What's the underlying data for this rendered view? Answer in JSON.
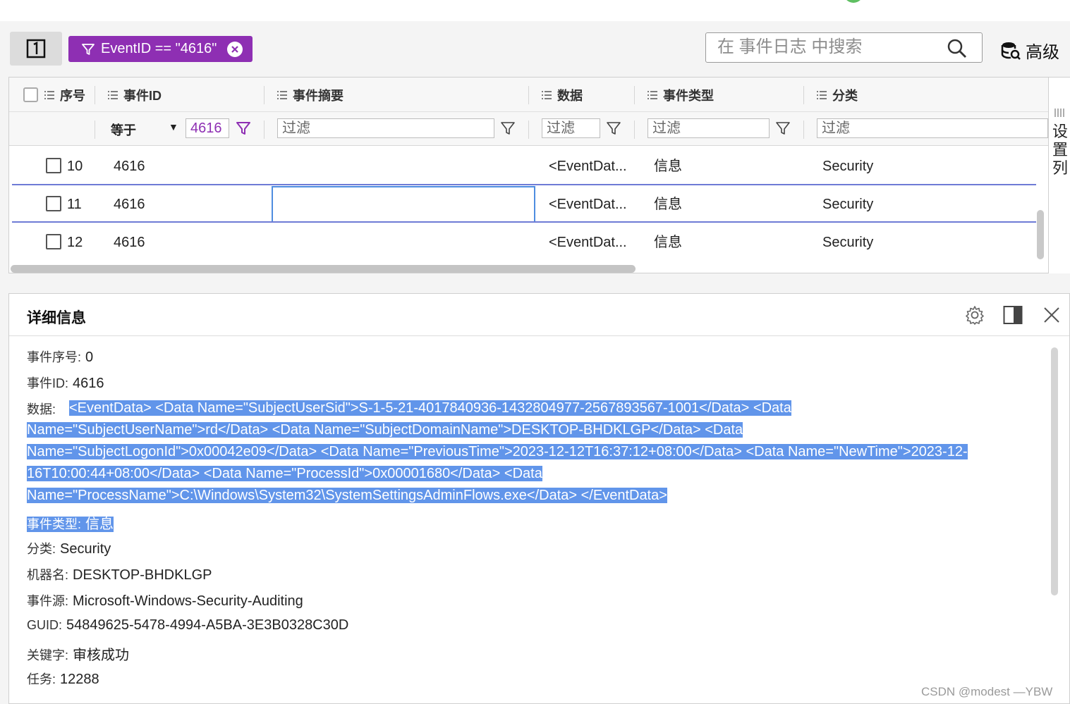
{
  "toolbar": {
    "filter_chip_label": "EventID == \"4616\"",
    "search_placeholder": "在 事件日志 中搜索",
    "advanced_label": "高级"
  },
  "grid": {
    "columns": [
      "序号",
      "事件ID",
      "事件摘要",
      "数据",
      "事件类型",
      "分类"
    ],
    "filter_operator": "等于",
    "filter_eventid_value": "4616",
    "filter_placeholder": "过滤",
    "column_settings_label": [
      "设",
      "置",
      "列"
    ],
    "rows": [
      {
        "seq": "10",
        "event_id": "4616",
        "summary": "",
        "data": "<EventDat...",
        "type": "信息",
        "category": "Security"
      },
      {
        "seq": "11",
        "event_id": "4616",
        "summary": "",
        "data": "<EventDat...",
        "type": "信息",
        "category": "Security"
      },
      {
        "seq": "12",
        "event_id": "4616",
        "summary": "",
        "data": "<EventDat...",
        "type": "信息",
        "category": "Security"
      }
    ]
  },
  "details": {
    "title": "详细信息",
    "seq_label": "事件序号:",
    "seq_value": "0",
    "id_label": "事件ID:",
    "id_value": "4616",
    "data_label": "数据:",
    "data_lines": [
      "<EventData> <Data Name=\"SubjectUserSid\">S-1-5-21-4017840936-1432804977-2567893567-1001</Data> <Data",
      "Name=\"SubjectUserName\">rd</Data> <Data Name=\"SubjectDomainName\">DESKTOP-BHDKLGP</Data> <Data",
      "Name=\"SubjectLogonId\">0x00042e09</Data> <Data Name=\"PreviousTime\">2023-12-12T16:37:12+08:00</Data> <Data Name=\"NewTime\">2023-12-",
      "16T10:00:44+08:00</Data> <Data Name=\"ProcessId\">0x00001680</Data> <Data",
      "Name=\"ProcessName\">C:\\Windows\\System32\\SystemSettingsAdminFlows.exe</Data> </EventData>"
    ],
    "type_label": "事件类型:",
    "type_value": "信息",
    "category_label": "分类:",
    "category_value": "Security",
    "machine_label": "机器名:",
    "machine_value": "DESKTOP-BHDKLGP",
    "source_label": "事件源:",
    "source_value": "Microsoft-Windows-Security-Auditing",
    "guid_label": "GUID:",
    "guid_value": "54849625-5478-4994-A5BA-3E3B0328C30D",
    "keyword_label": "关键字:",
    "keyword_value": "审核成功",
    "task_label": "任务:",
    "task_value": "12288"
  },
  "watermark": "CSDN @modest —YBW",
  "colors": {
    "chip": "#8e2fb3",
    "selection": "#6195ea",
    "row_separator": "#6e7bd6",
    "focus_border": "#4e8de0"
  }
}
